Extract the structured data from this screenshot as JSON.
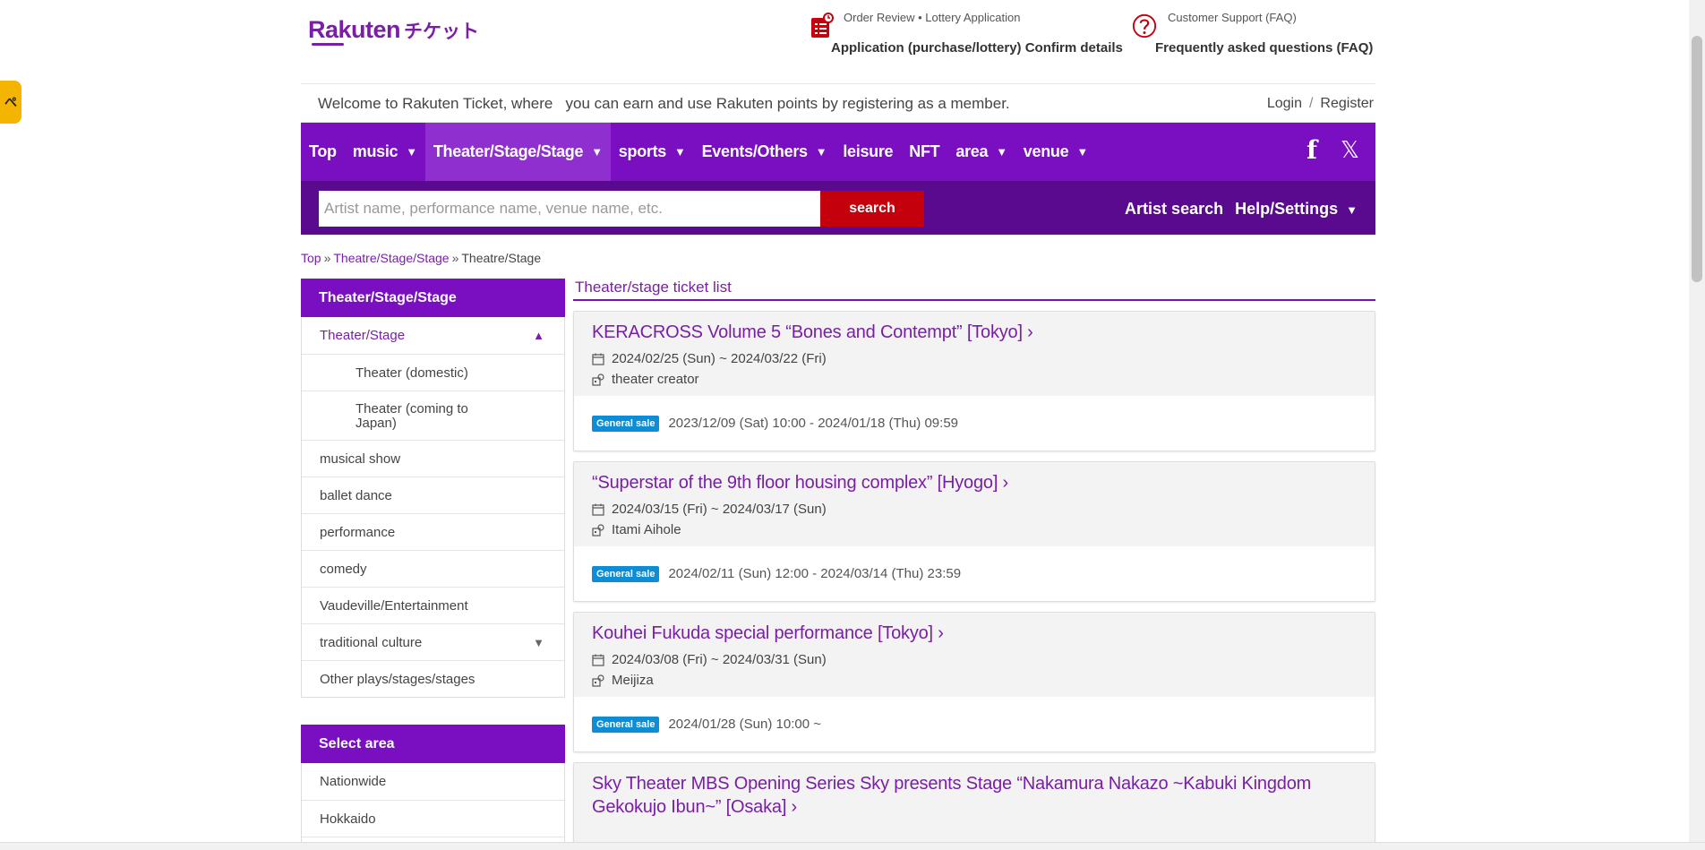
{
  "side_tab": {
    "glyph": "ぺ"
  },
  "header": {
    "logo_text": "Rakuten",
    "logo_sub": "チケット",
    "order": {
      "small": "Order Review • Lottery Application",
      "big": "Application (purchase/lottery) Confirm details"
    },
    "support": {
      "small": "Customer Support (FAQ)",
      "big": "Frequently asked questions (FAQ)"
    }
  },
  "welcome": {
    "message": "Welcome to Rakuten Ticket, where   you can earn and use Rakuten points by registering as a member.",
    "login": "Login",
    "separator": "/",
    "register": "Register"
  },
  "nav": {
    "items": [
      {
        "label": "Top"
      },
      {
        "label": "music"
      },
      {
        "label": "Theater/Stage/Stage"
      },
      {
        "label": "sports"
      },
      {
        "label": "Events/Others"
      },
      {
        "label": "leisure"
      },
      {
        "label": "NFT"
      },
      {
        "label": "area"
      },
      {
        "label": "venue"
      }
    ],
    "facebook": "f",
    "x": "𝕏"
  },
  "search": {
    "placeholder": "Artist name, performance name, venue name, etc.",
    "button": "search",
    "artist_search": "Artist search",
    "help": "Help/Settings"
  },
  "breadcrumb": {
    "top": "Top",
    "mid": "Theatre/Stage/Stage",
    "current": "Theatre/Stage",
    "sep": "»"
  },
  "sidebar": {
    "head": "Theater/Stage/Stage",
    "items": [
      {
        "label": "Theater/Stage"
      },
      {
        "label": "Theater (domestic)"
      },
      {
        "label": "Theater (coming to Japan)"
      },
      {
        "label": "musical show"
      },
      {
        "label": "ballet dance"
      },
      {
        "label": "performance"
      },
      {
        "label": "comedy"
      },
      {
        "label": "Vaudeville/Entertainment"
      },
      {
        "label": "traditional culture"
      },
      {
        "label": "Other plays/stages/stages"
      }
    ],
    "area_head": "Select area",
    "areas": [
      {
        "label": "Nationwide"
      },
      {
        "label": "Hokkaido"
      }
    ]
  },
  "list": {
    "title": "Theater/stage ticket list",
    "cards": [
      {
        "title": "KERACROSS Volume 5 “Bones and Contempt” [Tokyo] ›",
        "dates": "2024/02/25 (Sun) ~ 2024/03/22 (Fri)",
        "venue": "theater creator",
        "badge": "General sale",
        "sale": "2023/12/09 (Sat) 10:00 - 2024/01/18 (Thu) 09:59"
      },
      {
        "title": "“Superstar of the 9th floor housing complex” [Hyogo] ›",
        "dates": "2024/03/15 (Fri) ~ 2024/03/17 (Sun)",
        "venue": "Itami Aihole",
        "badge": "General sale",
        "sale": "2024/02/11 (Sun) 12:00 - 2024/03/14 (Thu) 23:59"
      },
      {
        "title": "Kouhei Fukuda special performance [Tokyo] ›",
        "dates": "2024/03/08 (Fri) ~ 2024/03/31 (Sun)",
        "venue": "Meijiza",
        "badge": "General sale",
        "sale": "2024/01/28 (Sun) 10:00 ~"
      },
      {
        "title_line1": "Sky Theater MBS Opening Series Sky presents Stage “Nakamura Nakazo ~Kabuki Kingdom",
        "title_line2": "Gekokujo Ibun~” [Osaka] ›"
      }
    ]
  },
  "colors": {
    "brand_purple": "#7a0fc1",
    "search_red": "#c4000d",
    "badge_blue": "#0d8dd6"
  }
}
